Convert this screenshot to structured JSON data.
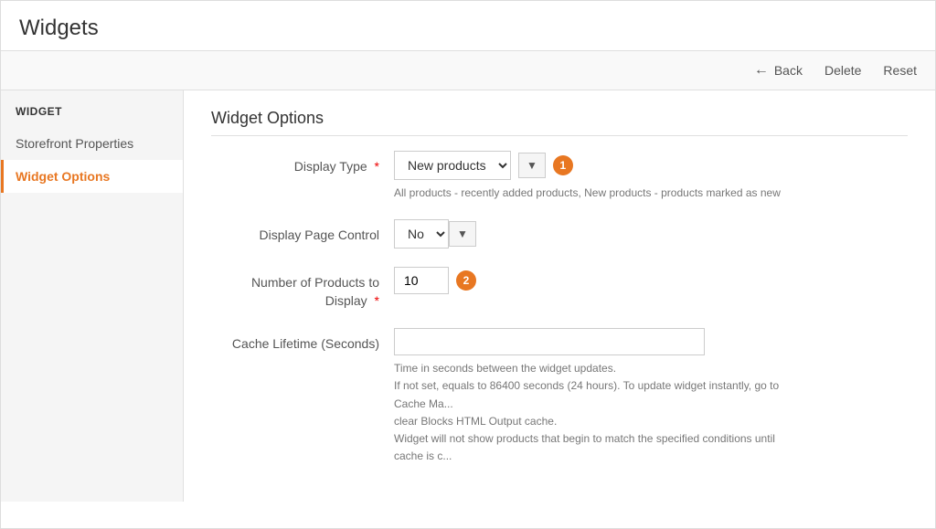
{
  "page": {
    "title": "Widgets"
  },
  "toolbar": {
    "back_label": "Back",
    "delete_label": "Delete",
    "reset_label": "Reset"
  },
  "sidebar": {
    "section_title": "WIDGET",
    "items": [
      {
        "id": "storefront",
        "label": "Storefront Properties",
        "active": false
      },
      {
        "id": "widget-options",
        "label": "Widget Options",
        "active": true
      }
    ]
  },
  "main": {
    "section_title": "Widget Options",
    "fields": {
      "display_type": {
        "label": "Display Type",
        "required": true,
        "value": "New products",
        "badge": "1",
        "hint": "All products - recently added products, New products - products marked as new"
      },
      "display_page_control": {
        "label": "Display Page Control",
        "required": false,
        "value": "No",
        "badge": null
      },
      "number_of_products": {
        "label": "Number of Products to Display",
        "required": true,
        "value": "10",
        "badge": "2"
      },
      "cache_lifetime": {
        "label": "Cache Lifetime (Seconds)",
        "required": false,
        "value": "",
        "hint_lines": [
          "Time in seconds between the widget updates.",
          "If not set, equals to 86400 seconds (24 hours). To update widget instantly, go to Cache Ma...",
          "clear Blocks HTML Output cache.",
          "Widget will not show products that begin to match the specified conditions until cache is c..."
        ]
      }
    }
  }
}
